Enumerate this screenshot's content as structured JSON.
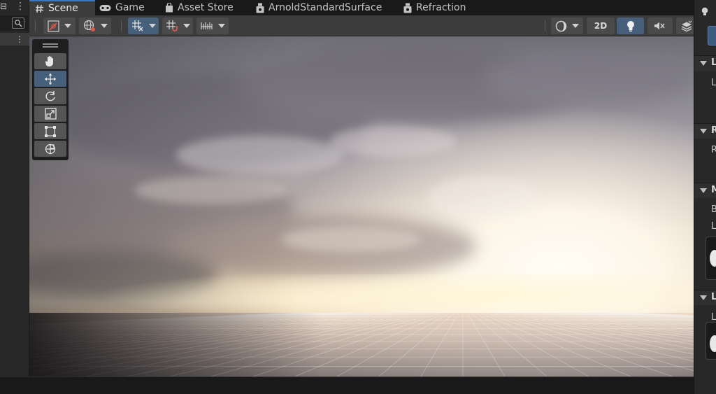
{
  "tabs": [
    {
      "label": "Scene",
      "icon": "hash-icon",
      "active": true
    },
    {
      "label": "Game",
      "icon": "gamepad-icon",
      "active": false
    },
    {
      "label": "Asset Store",
      "icon": "shopping-bag-icon",
      "active": false
    },
    {
      "label": "ArnoldStandardSurface",
      "icon": "node-graph-icon",
      "active": false
    },
    {
      "label": "Refraction",
      "icon": "node-graph-icon",
      "active": false
    }
  ],
  "toolbar": {
    "mode_2d_label": "2D",
    "icons": [
      "draw-mode-icon",
      "globe-icon",
      "grid-snap-icon",
      "increment-snap-icon",
      "ruler-icon",
      "shading-sphere-icon",
      "lighting-bulb-icon",
      "audio-mute-icon",
      "effects-layers-icon"
    ]
  },
  "tools": [
    {
      "name": "hand-tool",
      "icon": "hand-icon",
      "active": false
    },
    {
      "name": "move-tool",
      "icon": "move-arrows-icon",
      "active": true
    },
    {
      "name": "rotate-tool",
      "icon": "rotate-icon",
      "active": false
    },
    {
      "name": "scale-tool",
      "icon": "scale-icon",
      "active": false
    },
    {
      "name": "rect-tool",
      "icon": "rect-transform-icon",
      "active": false
    },
    {
      "name": "transform-tool",
      "icon": "transform-icon",
      "active": false
    }
  ],
  "inspector": {
    "sections": [
      {
        "letter": "L",
        "rows": [
          "L"
        ]
      },
      {
        "letter": "R",
        "rows": [
          "R"
        ]
      },
      {
        "letter": "M",
        "rows": [
          "B",
          "L"
        ]
      },
      {
        "letter": "L",
        "rows": [
          "L"
        ]
      }
    ]
  },
  "colors": {
    "accent": "#3a79bb",
    "active_button": "#46607c",
    "panel": "#3c3c3c",
    "background": "#191919"
  }
}
